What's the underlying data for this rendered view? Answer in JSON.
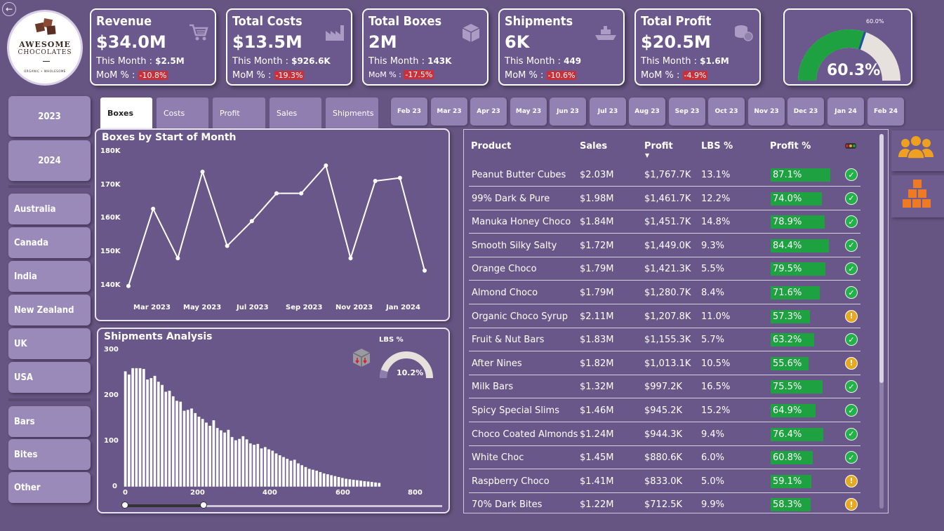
{
  "logo": {
    "line1": "AWESOME",
    "line2": "CHOCOLATES",
    "arc": "ORGANIC • WHOLESOME"
  },
  "kpis": [
    {
      "title": "Revenue",
      "value": "$34.0M",
      "month_label": "This Month :",
      "month_value": "$2.5M",
      "mom_label": "MoM % :",
      "mom_value": "-10.8%",
      "icon": "shopping-cart-icon"
    },
    {
      "title": "Total Costs",
      "value": "$13.5M",
      "month_label": "This Month :",
      "month_value": "$926.6K",
      "mom_label": "MoM % :",
      "mom_value": "-19.3%",
      "icon": "factory-icon"
    },
    {
      "title": "Total Boxes",
      "value": "2M",
      "month_label": "This Month :",
      "month_value": "143K",
      "mom_label": "MoM % :",
      "mom_value": "-17.5%",
      "icon": "box-icon"
    },
    {
      "title": "Shipments",
      "value": "6K",
      "month_label": "This Month :",
      "month_value": "449",
      "mom_label": "MoM % :",
      "mom_value": "-10.6%",
      "icon": "ship-icon"
    },
    {
      "title": "Total Profit",
      "value": "$20.5M",
      "month_label": "This Month :",
      "month_value": "$1.6M",
      "mom_label": "MoM % :",
      "mom_value": "-4.9%",
      "icon": "coins-icon"
    }
  ],
  "gauge": {
    "value": 0.603,
    "label": "60.3%",
    "target_label": "60.0%",
    "colors": {
      "fill": "#1ea140",
      "track": "#e6e1dc",
      "target": "#1f4fa0"
    }
  },
  "years": [
    "2023",
    "2024"
  ],
  "countries": [
    "Australia",
    "Canada",
    "India",
    "New Zealand",
    "UK",
    "USA"
  ],
  "categories": [
    "Bars",
    "Bites",
    "Other"
  ],
  "tabs": [
    {
      "label": "Boxes",
      "active": true
    },
    {
      "label": "Costs",
      "active": false
    },
    {
      "label": "Profit",
      "active": false
    },
    {
      "label": "Sales",
      "active": false
    },
    {
      "label": "Shipments",
      "active": false
    }
  ],
  "months": [
    "Feb 23",
    "Mar 23",
    "Apr 23",
    "May 23",
    "Jun 23",
    "Jul 23",
    "Aug 23",
    "Sep 23",
    "Oct 23",
    "Nov 23",
    "Dec 23",
    "Jan 24",
    "Feb 24"
  ],
  "line_chart": {
    "title": "Boxes by Start of Month",
    "yticks": [
      "180K",
      "170K",
      "160K",
      "150K",
      "140K"
    ],
    "xticks": [
      "Mar 2023",
      "May 2023",
      "Jul 2023",
      "Sep 2023",
      "Nov 2023",
      "Jan 2024"
    ]
  },
  "hist_chart": {
    "title": "Shipments Analysis",
    "yticks": [
      "300",
      "200",
      "100",
      "0"
    ],
    "xticks": [
      "0",
      "200",
      "400",
      "600",
      "800"
    ],
    "lbs_label": "LBS %",
    "lbs_value": "10.2%",
    "lbs_fraction": 0.102
  },
  "chart_data": [
    {
      "type": "line",
      "title": "Boxes by Start of Month",
      "x": [
        "Feb 2023",
        "Mar 2023",
        "Apr 2023",
        "May 2023",
        "Jun 2023",
        "Jul 2023",
        "Aug 2023",
        "Sep 2023",
        "Oct 2023",
        "Nov 2023",
        "Dec 2023",
        "Jan 2024",
        "Feb 2024"
      ],
      "y": [
        138000,
        163000,
        147000,
        175000,
        151000,
        159000,
        168000,
        168000,
        177000,
        147000,
        172000,
        173000,
        143000
      ],
      "ylim": [
        135000,
        182000
      ]
    },
    {
      "type": "bar",
      "title": "Shipments Analysis",
      "x_start": 0,
      "bin_width": 10,
      "values": [
        255,
        248,
        262,
        262,
        262,
        260,
        237,
        240,
        245,
        232,
        225,
        210,
        212,
        200,
        190,
        188,
        168,
        170,
        173,
        163,
        155,
        150,
        142,
        135,
        147,
        130,
        125,
        120,
        126,
        110,
        103,
        106,
        112,
        105,
        96,
        93,
        95,
        85,
        88,
        83,
        80,
        74,
        70,
        66,
        62,
        58,
        60,
        52,
        48,
        44,
        40,
        38,
        36,
        33,
        30,
        28,
        26,
        24,
        22,
        20,
        18,
        17,
        16,
        15,
        14,
        13,
        12,
        11,
        10,
        9
      ],
      "xlim": [
        0,
        870
      ],
      "ylim": [
        0,
        300
      ]
    }
  ],
  "table": {
    "headers": {
      "product": "Product",
      "sales": "Sales",
      "profit": "Profit",
      "lbs": "LBS %",
      "profit_pct": "Profit %"
    },
    "rows": [
      {
        "product": "Peanut Butter Cubes",
        "sales": "$2.03M",
        "profit": "$1,767.7K",
        "lbs": "13.1%",
        "profit_pct": "87.1%",
        "pct": 87.1,
        "status": "ok"
      },
      {
        "product": "99% Dark & Pure",
        "sales": "$1.98M",
        "profit": "$1,461.7K",
        "lbs": "12.2%",
        "profit_pct": "74.0%",
        "pct": 74.0,
        "status": "ok"
      },
      {
        "product": "Manuka Honey Choco",
        "sales": "$1.84M",
        "profit": "$1,451.7K",
        "lbs": "14.8%",
        "profit_pct": "78.9%",
        "pct": 78.9,
        "status": "ok"
      },
      {
        "product": "Smooth Silky Salty",
        "sales": "$1.72M",
        "profit": "$1,449.0K",
        "lbs": "9.3%",
        "profit_pct": "84.4%",
        "pct": 84.4,
        "status": "ok"
      },
      {
        "product": "Orange Choco",
        "sales": "$1.79M",
        "profit": "$1,421.3K",
        "lbs": "5.5%",
        "profit_pct": "79.5%",
        "pct": 79.5,
        "status": "ok"
      },
      {
        "product": "Almond Choco",
        "sales": "$1.79M",
        "profit": "$1,280.7K",
        "lbs": "8.4%",
        "profit_pct": "71.6%",
        "pct": 71.6,
        "status": "ok"
      },
      {
        "product": "Organic Choco Syrup",
        "sales": "$2.11M",
        "profit": "$1,207.8K",
        "lbs": "11.0%",
        "profit_pct": "57.3%",
        "pct": 57.3,
        "status": "warn"
      },
      {
        "product": "Fruit & Nut Bars",
        "sales": "$1.83M",
        "profit": "$1,155.3K",
        "lbs": "5.7%",
        "profit_pct": "63.2%",
        "pct": 63.2,
        "status": "ok"
      },
      {
        "product": "After Nines",
        "sales": "$1.82M",
        "profit": "$1,013.1K",
        "lbs": "10.5%",
        "profit_pct": "55.6%",
        "pct": 55.6,
        "status": "warn"
      },
      {
        "product": "Milk Bars",
        "sales": "$1.32M",
        "profit": "$997.2K",
        "lbs": "16.5%",
        "profit_pct": "75.5%",
        "pct": 75.5,
        "status": "ok"
      },
      {
        "product": "Spicy Special Slims",
        "sales": "$1.46M",
        "profit": "$945.2K",
        "lbs": "15.2%",
        "profit_pct": "64.9%",
        "pct": 64.9,
        "status": "ok"
      },
      {
        "product": "Choco Coated Almonds",
        "sales": "$1.24M",
        "profit": "$944.3K",
        "lbs": "9.4%",
        "profit_pct": "76.4%",
        "pct": 76.4,
        "status": "ok"
      },
      {
        "product": "White Choc",
        "sales": "$1.45M",
        "profit": "$880.6K",
        "lbs": "6.0%",
        "profit_pct": "60.8%",
        "pct": 60.8,
        "status": "ok"
      },
      {
        "product": "Raspberry Choco",
        "sales": "$1.41M",
        "profit": "$833.0K",
        "lbs": "5.0%",
        "profit_pct": "59.1%",
        "pct": 59.1,
        "status": "warn"
      },
      {
        "product": "70% Dark Bites",
        "sales": "$1.22M",
        "profit": "$712.5K",
        "lbs": "9.9%",
        "profit_pct": "58.3%",
        "pct": 58.3,
        "status": "warn"
      }
    ]
  },
  "nav_icons": [
    "people-icon",
    "boxes-stack-icon"
  ],
  "colors": {
    "background": "#665482",
    "positive": "#1ea140",
    "negative": "#c8303c",
    "warning": "#e8a920",
    "accent": "#f0a020"
  }
}
